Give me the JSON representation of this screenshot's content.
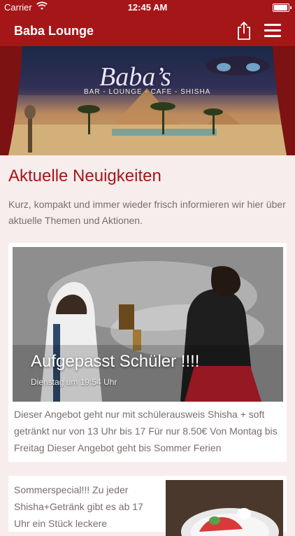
{
  "status_bar": {
    "carrier": "Carrier",
    "time": "12:45 AM",
    "battery_level": 0.95
  },
  "nav": {
    "title": "Baba Lounge",
    "share_icon": "share-icon",
    "menu_icon": "hamburger-menu-icon"
  },
  "banner": {
    "logo_text": "Baba’s",
    "tagline": "BAR - LOUNGE - CAFE - SHISHA"
  },
  "section": {
    "title": "Aktuelle Neuigkeiten",
    "intro": "Kurz, kompakt und immer wieder frisch informieren wir hier über aktuelle Themen und Aktionen."
  },
  "posts": [
    {
      "title": "Aufgepasst Schüler !!!!",
      "date": "Dienstag um 19:54 Uhr",
      "body": "Dieser Angebot geht nur mit schülerausweis Shisha + soft getränkt nur von 13 Uhr bis 17 Für nur 8.50€ Von Montag bis Freitag Dieser Angebot geht bis Sommer Ferien"
    },
    {
      "body": "Sommerspecial!!! Zu jeder Shisha+Getränk gibt es ab 17 Uhr ein Stück leckere"
    }
  ],
  "colors": {
    "brand": "#a51618",
    "background": "#f8eded",
    "body_text": "#7a6c6c"
  }
}
